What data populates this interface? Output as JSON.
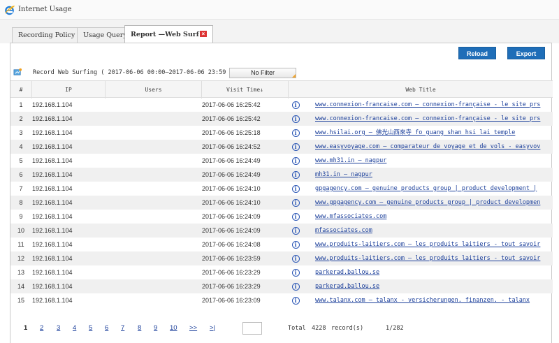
{
  "app": {
    "title": "Internet Usage"
  },
  "tabs": [
    {
      "label": "Recording Policy"
    },
    {
      "label": "Usage Query"
    },
    {
      "label": "Report —Web Surf"
    }
  ],
  "toolbar": {
    "reload_label": "Reload",
    "export_label": "Export"
  },
  "record_info": {
    "text": "Record Web Surfing ( 2017-06-06 00:00—2017-06-06 23:59 )"
  },
  "filter": {
    "label": "No Filter"
  },
  "table": {
    "headers": {
      "num": "#",
      "ip": "IP",
      "users": "Users",
      "visit_time": "Visit Time↓",
      "web_title": "Web Title"
    },
    "rows": [
      {
        "num": "1",
        "ip": "192.168.1.104",
        "user": "",
        "time": "2017-06-06 16:25:42",
        "title": "www.connexion-francaise.com    —    connexion-française - le site prs"
      },
      {
        "num": "2",
        "ip": "192.168.1.104",
        "user": "",
        "time": "2017-06-06 16:25:42",
        "title": "www.connexion-francaise.com    —    connexion-française - le site prs"
      },
      {
        "num": "3",
        "ip": "192.168.1.104",
        "user": "",
        "time": "2017-06-06 16:25:18",
        "title": "www.hsilai.org    —    佛光山西來寺 fo guang shan hsi lai temple"
      },
      {
        "num": "4",
        "ip": "192.168.1.104",
        "user": "",
        "time": "2017-06-06 16:24:52",
        "title": "www.easyvoyage.com    —    comparateur de voyage et de vols - easyvov"
      },
      {
        "num": "5",
        "ip": "192.168.1.104",
        "user": "",
        "time": "2017-06-06 16:24:49",
        "title": "www.mh31.in    —    nagpur"
      },
      {
        "num": "6",
        "ip": "192.168.1.104",
        "user": "",
        "time": "2017-06-06 16:24:49",
        "title": "mh31.in    —    nagpur"
      },
      {
        "num": "7",
        "ip": "192.168.1.104",
        "user": "",
        "time": "2017-06-06 16:24:10",
        "title": "gpgagency.com    —    genuine products group | product development |"
      },
      {
        "num": "8",
        "ip": "192.168.1.104",
        "user": "",
        "time": "2017-06-06 16:24:10",
        "title": "www.gpgagency.com    —    genuine products group | product developmen"
      },
      {
        "num": "9",
        "ip": "192.168.1.104",
        "user": "",
        "time": "2017-06-06 16:24:09",
        "title": "www.mfassociates.com"
      },
      {
        "num": "10",
        "ip": "192.168.1.104",
        "user": "",
        "time": "2017-06-06 16:24:09",
        "title": "mfassociates.com"
      },
      {
        "num": "11",
        "ip": "192.168.1.104",
        "user": "",
        "time": "2017-06-06 16:24:08",
        "title": "www.produits-laitiers.com    —    les produits laitiers - tout savoir"
      },
      {
        "num": "12",
        "ip": "192.168.1.104",
        "user": "",
        "time": "2017-06-06 16:23:59",
        "title": "www.produits-laitiers.com    —    les produits laitiers - tout savoir"
      },
      {
        "num": "13",
        "ip": "192.168.1.104",
        "user": "",
        "time": "2017-06-06 16:23:29",
        "title": "parkerad.ballou.se"
      },
      {
        "num": "14",
        "ip": "192.168.1.104",
        "user": "",
        "time": "2017-06-06 16:23:29",
        "title": "parkerad.ballou.se"
      },
      {
        "num": "15",
        "ip": "192.168.1.104",
        "user": "",
        "time": "2017-06-06 16:23:09",
        "title": "www.talanx.com    —    talanx - versicherungen. finanzen. - talanx"
      }
    ]
  },
  "pagination": {
    "pages": [
      "1",
      "2",
      "3",
      "4",
      "5",
      "6",
      "7",
      "8",
      "9",
      "10"
    ],
    "current": "1",
    "next": ">>",
    "last": ">|",
    "total_label": "Total",
    "total_value": "4228",
    "records_label": "record(s)",
    "page_status": "1/282"
  },
  "colors": {
    "accent": "#1f6eb8",
    "link": "#1a3e9a",
    "alt_row": "#f0f0f0"
  },
  "icons": {
    "app": "ie-icon",
    "record": "record-icon",
    "info": "info-icon",
    "close": "close-icon"
  }
}
